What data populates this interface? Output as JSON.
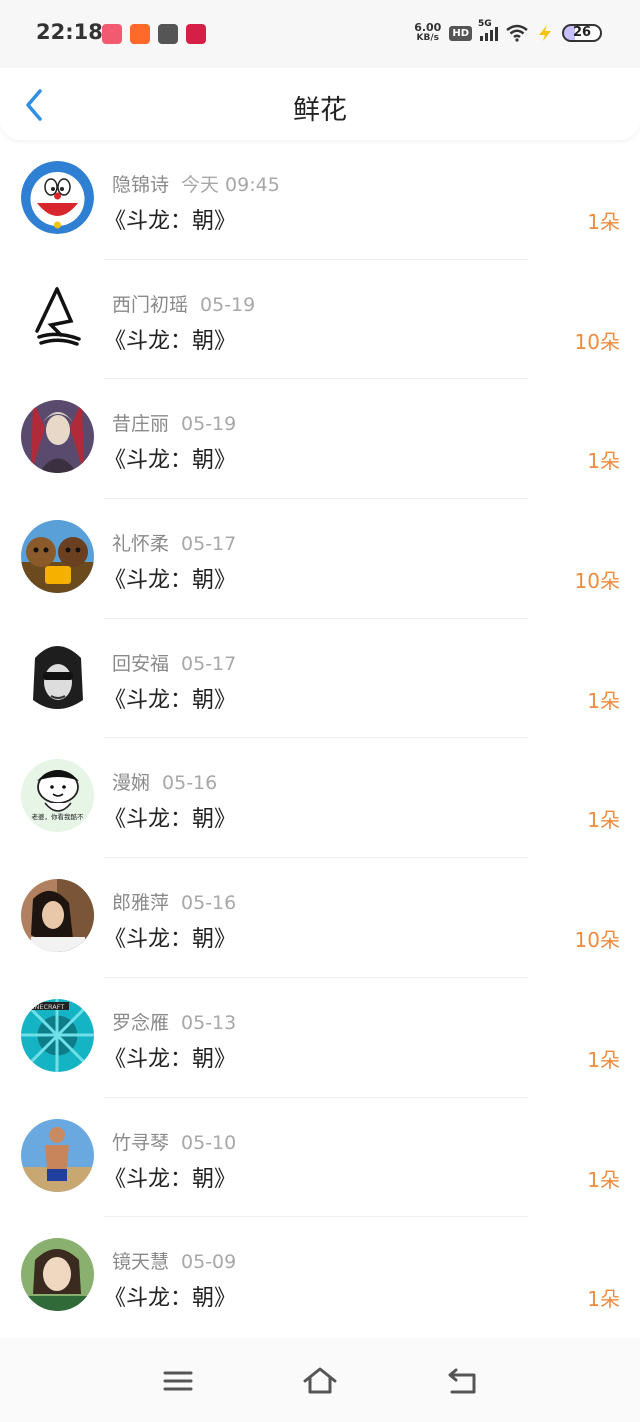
{
  "status_bar": {
    "time": "22:18",
    "net_speed_value": "6.00",
    "net_speed_unit": "KB/s",
    "hd_label": "HD",
    "network_label": "5G",
    "battery_level": "26"
  },
  "header": {
    "title": "鲜花"
  },
  "items": [
    {
      "name": "隐锦诗",
      "date": "今天 09:45",
      "book": "《斗龙：朝》",
      "count": "1朵"
    },
    {
      "name": "西门初瑶",
      "date": "05-19",
      "book": "《斗龙：朝》",
      "count": "10朵"
    },
    {
      "name": "昔庄丽",
      "date": "05-19",
      "book": "《斗龙：朝》",
      "count": "1朵"
    },
    {
      "name": "礼怀柔",
      "date": "05-17",
      "book": "《斗龙：朝》",
      "count": "10朵"
    },
    {
      "name": "回安福",
      "date": "05-17",
      "book": "《斗龙：朝》",
      "count": "1朵"
    },
    {
      "name": "漫娴",
      "date": "05-16",
      "book": "《斗龙：朝》",
      "count": "1朵",
      "avatar_text": "老婆，你看我酷不"
    },
    {
      "name": "郎雅萍",
      "date": "05-16",
      "book": "《斗龙：朝》",
      "count": "10朵"
    },
    {
      "name": "罗念雁",
      "date": "05-13",
      "book": "《斗龙：朝》",
      "count": "1朵",
      "avatar_text": "MINECRAFT"
    },
    {
      "name": "竹寻琴",
      "date": "05-10",
      "book": "《斗龙：朝》",
      "count": "1朵"
    },
    {
      "name": "镜天慧",
      "date": "05-09",
      "book": "《斗龙：朝》",
      "count": "1朵"
    }
  ],
  "colors": {
    "accent_blue": "#2f8fe6",
    "count_orange": "#f08a3c",
    "name_gray": "#8a8a8a"
  },
  "icons": {
    "back": "chevron-left-icon",
    "menu": "menu-icon",
    "home": "home-icon",
    "return": "return-icon"
  }
}
